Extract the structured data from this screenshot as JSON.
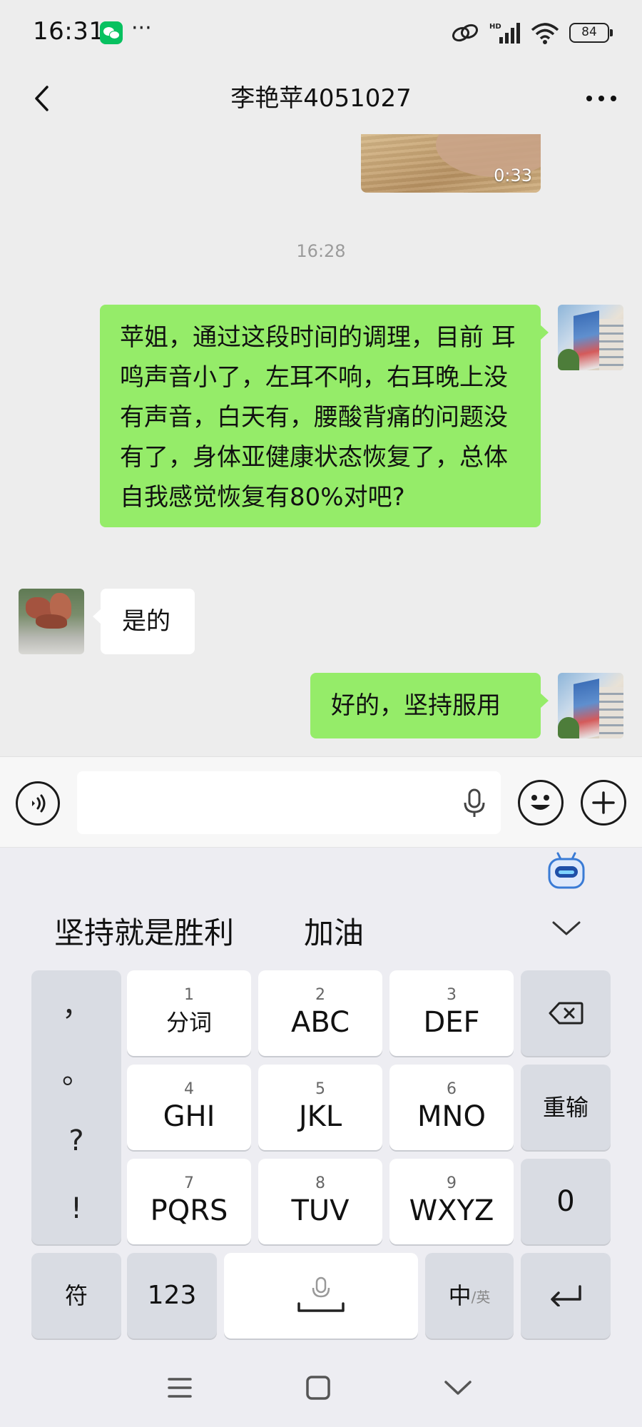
{
  "status_bar": {
    "time": "16:31",
    "more_dots": "···",
    "network": "HD",
    "battery": "84"
  },
  "nav": {
    "title": "李艳苹4051027"
  },
  "video_message": {
    "duration": "0:33"
  },
  "time_divider": "16:28",
  "messages": [
    {
      "side": "sent",
      "text": "苹姐，通过这段时间的调理，目前 耳鸣声音小了，左耳不响，右耳晚上没有声音，白天有，腰酸背痛的问题没有了，身体亚健康状态恢复了，总体自我感觉恢复有80%对吧?"
    },
    {
      "side": "received",
      "text": "是的"
    },
    {
      "side": "sent",
      "text": "好的，坚持服用"
    }
  ],
  "input": {
    "placeholder": ""
  },
  "keyboard": {
    "candidates": [
      "坚持就是胜利",
      "加油"
    ],
    "punctuation": [
      "，",
      "。",
      "?",
      "!"
    ],
    "keys": [
      {
        "num": "1",
        "label": "分词"
      },
      {
        "num": "2",
        "label": "ABC"
      },
      {
        "num": "3",
        "label": "DEF"
      },
      {
        "num": "4",
        "label": "GHI"
      },
      {
        "num": "5",
        "label": "JKL"
      },
      {
        "num": "6",
        "label": "MNO"
      },
      {
        "num": "7",
        "label": "PQRS"
      },
      {
        "num": "8",
        "label": "TUV"
      },
      {
        "num": "9",
        "label": "WXYZ"
      }
    ],
    "reinput": "重输",
    "zero": "0",
    "symbols": "符",
    "numbers": "123",
    "lang_main": "中",
    "lang_alt": "/英"
  },
  "colors": {
    "sent_bubble": "#95ec69",
    "received_bubble": "#ffffff",
    "chat_background": "#ededed",
    "wechat_green": "#07c160"
  }
}
